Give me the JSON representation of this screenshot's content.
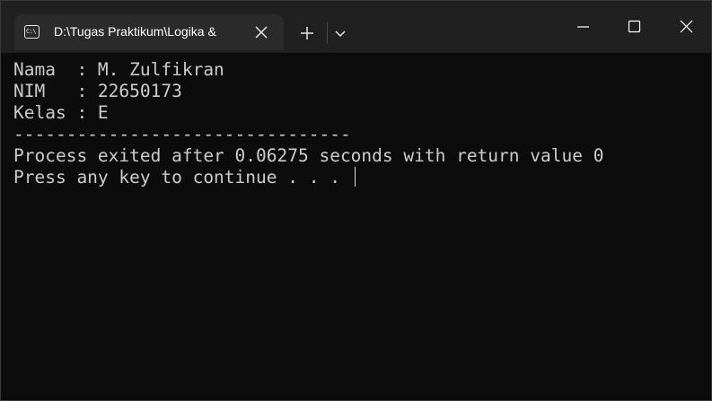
{
  "tab": {
    "title": "D:\\Tugas Praktikum\\Logika & ",
    "icon": "console-icon",
    "icon_glyph": "C:\\"
  },
  "titlebar_icons": {
    "close_tab": "close-icon",
    "new_tab": "plus-icon",
    "dropdown": "chevron-down-icon",
    "minimize": "minimize-icon",
    "maximize": "maximize-icon",
    "close_window": "close-icon"
  },
  "terminal": {
    "lines": [
      "Nama  : M. Zulfikran",
      "NIM   : 22650173",
      "Kelas : E",
      "--------------------------------",
      "Process exited after 0.06275 seconds with return value 0",
      "Press any key to continue . . . "
    ]
  },
  "colors": {
    "background": "#0c0c0c",
    "titlebar": "#202020",
    "tab": "#2b2b2b",
    "text": "#cccccc"
  }
}
